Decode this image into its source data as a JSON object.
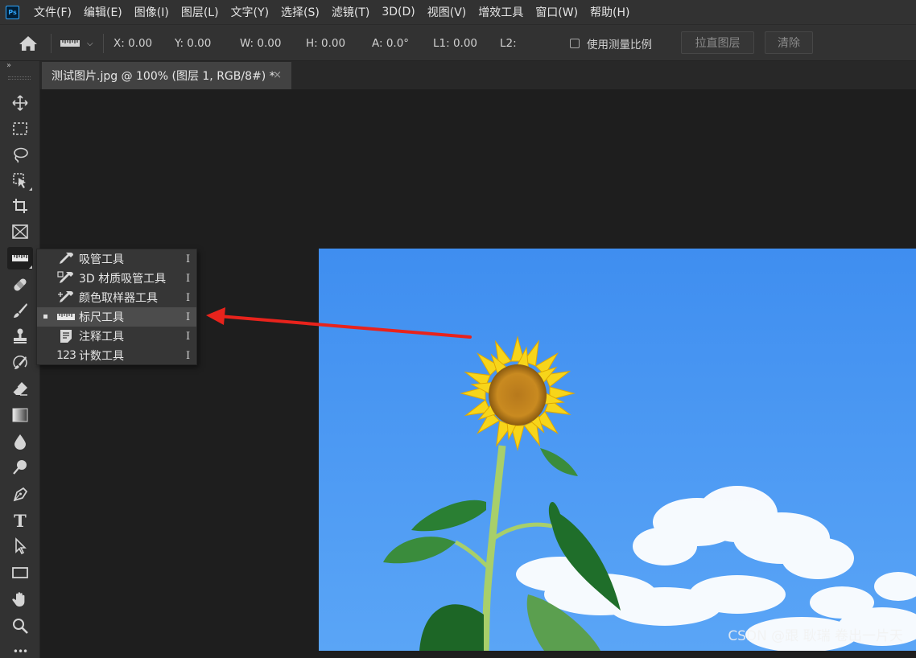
{
  "app": {
    "logo_text": "Ps"
  },
  "menu": [
    "文件(F)",
    "编辑(E)",
    "图像(I)",
    "图层(L)",
    "文字(Y)",
    "选择(S)",
    "滤镜(T)",
    "3D(D)",
    "视图(V)",
    "增效工具",
    "窗口(W)",
    "帮助(H)"
  ],
  "options": {
    "x": "X: 0.00",
    "y": "Y: 0.00",
    "w": "W: 0.00",
    "h": "H: 0.00",
    "a": "A: 0.0°",
    "l1": "L1: 0.00",
    "l2": "L2:",
    "use_scale_label": "使用测量比例",
    "use_scale_checked": false,
    "straighten_label": "拉直图层",
    "clear_label": "清除"
  },
  "tab": {
    "title": "测试图片.jpg @ 100% (图层 1, RGB/8#) *",
    "close": "×"
  },
  "toolbar": {
    "collapse": "››",
    "tools": [
      "move-tool",
      "marquee-tool",
      "lasso-tool",
      "object-select-tool",
      "crop-tool",
      "frame-tool",
      "ruler-tool",
      "healing-brush-tool",
      "brush-tool",
      "stamp-tool",
      "history-brush-tool",
      "eraser-tool",
      "gradient-tool",
      "blur-tool",
      "dodge-tool",
      "pen-tool",
      "type-tool",
      "path-select-tool",
      "rectangle-tool",
      "hand-tool",
      "zoom-tool",
      "more-tools"
    ],
    "type_glyph": "T",
    "more_glyph": "•••"
  },
  "flyout": {
    "items": [
      {
        "label": "吸管工具",
        "key": "I",
        "icon": "eyedropper-icon",
        "selected": false
      },
      {
        "label": "3D 材质吸管工具",
        "key": "I",
        "icon": "3d-material-eyedropper-icon",
        "selected": false
      },
      {
        "label": "颜色取样器工具",
        "key": "I",
        "icon": "color-sampler-icon",
        "selected": false
      },
      {
        "label": "标尺工具",
        "key": "I",
        "icon": "ruler-icon",
        "selected": true
      },
      {
        "label": "注释工具",
        "key": "I",
        "icon": "note-icon",
        "selected": false
      },
      {
        "label": "计数工具",
        "key": "I",
        "icon": "count-icon",
        "selected": false
      }
    ],
    "count_icon_text": "123"
  },
  "canvas": {
    "watermark": "CSDN @跟 耿瑞 卷出一片天"
  },
  "colors": {
    "annotation_arrow": "#e8231c",
    "sky": "#4a96f0",
    "menubar": "#323232"
  }
}
